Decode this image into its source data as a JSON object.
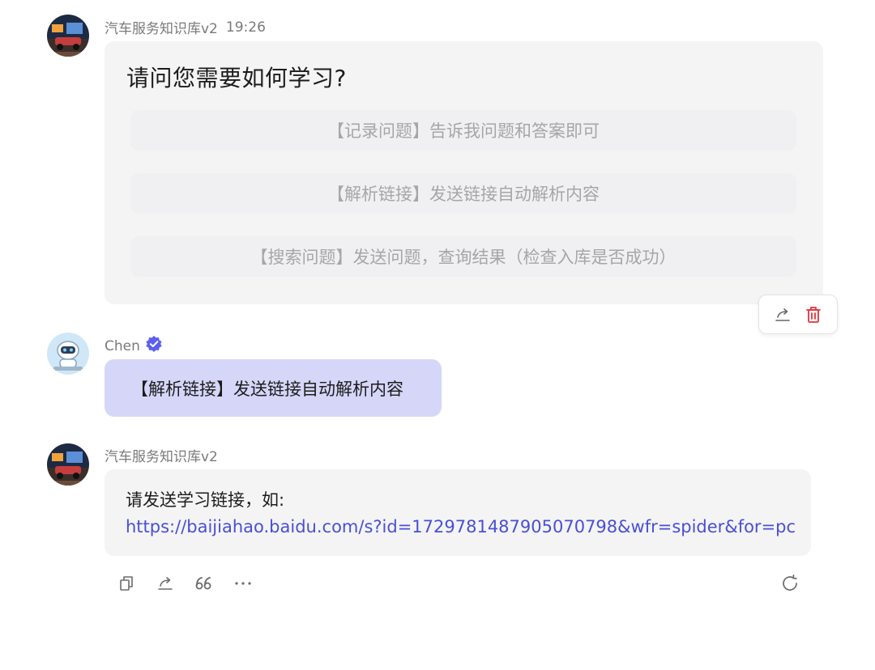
{
  "messages": [
    {
      "sender": "汽车服务知识库v2",
      "time": "19:26",
      "question": "请问您需要如何学习?",
      "options": [
        "【记录问题】告诉我问题和答案即可",
        "【解析链接】发送链接自动解析内容",
        "【搜索问题】发送问题，查询结果（检查入库是否成功）"
      ]
    },
    {
      "sender": "Chen",
      "verified": true,
      "text": "【解析链接】发送链接自动解析内容"
    },
    {
      "sender": "汽车服务知识库v2",
      "text": "请发送学习链接，如:",
      "link": "https://baijiahao.baidu.com/s?id=1729781487905070798&wfr=spider&for=pc"
    }
  ],
  "colors": {
    "user_bubble": "#d6d6f9",
    "bot_bubble": "#f4f4f5",
    "link": "#4a4fd6",
    "delete": "#e0343a",
    "verified_badge": "#5a5ff0"
  },
  "icons": [
    "share-icon",
    "trash-icon",
    "copy-icon",
    "quote-icon",
    "more-icon",
    "refresh-icon",
    "verified-badge-icon"
  ]
}
